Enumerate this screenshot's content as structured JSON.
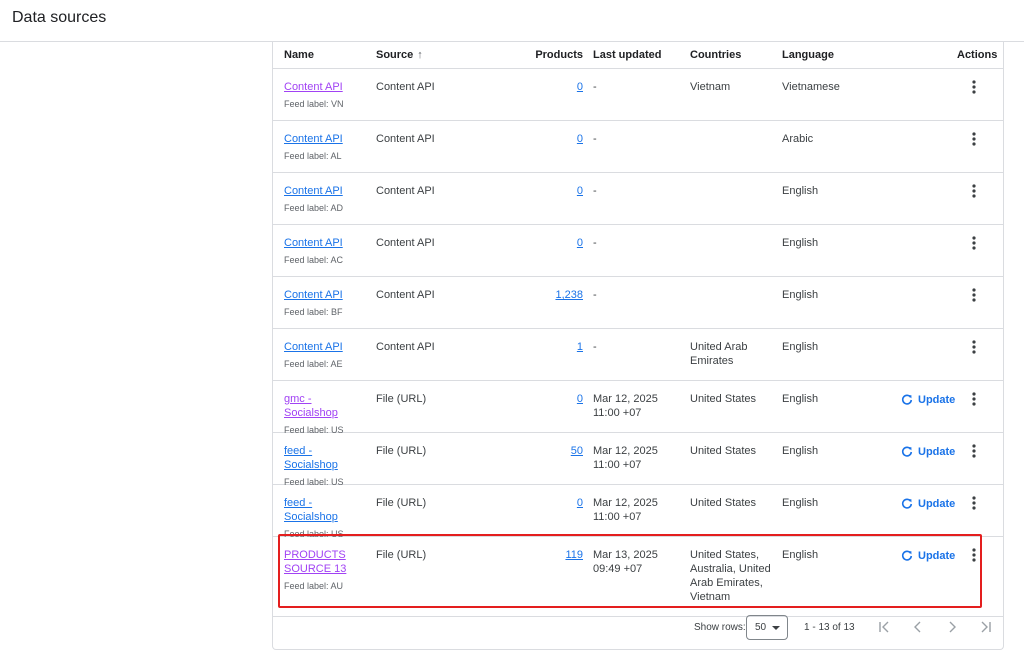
{
  "page": {
    "title": "Data sources"
  },
  "table": {
    "headers": {
      "name": "Name",
      "source": "Source",
      "products": "Products",
      "last_updated": "Last updated",
      "countries": "Countries",
      "language": "Language",
      "actions": "Actions"
    },
    "rows": [
      {
        "name": "Content API",
        "visited": true,
        "feed_label": "Feed label: VN",
        "source": "Content API",
        "products": "0",
        "last_updated": "-",
        "countries": "Vietnam",
        "language": "Vietnamese",
        "update": ""
      },
      {
        "name": "Content API",
        "visited": false,
        "feed_label": "Feed label: AL",
        "source": "Content API",
        "products": "0",
        "last_updated": "-",
        "countries": "",
        "language": "Arabic",
        "update": ""
      },
      {
        "name": "Content API",
        "visited": false,
        "feed_label": "Feed label: AD",
        "source": "Content API",
        "products": "0",
        "last_updated": "-",
        "countries": "",
        "language": "English",
        "update": ""
      },
      {
        "name": "Content API",
        "visited": false,
        "feed_label": "Feed label: AC",
        "source": "Content API",
        "products": "0",
        "last_updated": "-",
        "countries": "",
        "language": "English",
        "update": ""
      },
      {
        "name": "Content API",
        "visited": false,
        "feed_label": "Feed label: BF",
        "source": "Content API",
        "products": "1,238",
        "last_updated": "-",
        "countries": "",
        "language": "English",
        "update": ""
      },
      {
        "name": "Content API",
        "visited": false,
        "feed_label": "Feed label: AE",
        "source": "Content API",
        "products": "1",
        "last_updated": "-",
        "countries": "United Arab Emirates",
        "language": "English",
        "update": ""
      },
      {
        "name": "gmc - Socialshop",
        "visited": true,
        "feed_label": "Feed label: US",
        "source": "File (URL)",
        "products": "0",
        "last_updated": "Mar 12, 2025 11:00 +07",
        "countries": "United States",
        "language": "English",
        "update": "Update"
      },
      {
        "name": "feed - Socialshop",
        "visited": false,
        "feed_label": "Feed label: US",
        "source": "File (URL)",
        "products": "50",
        "last_updated": "Mar 12, 2025 11:00 +07",
        "countries": "United States",
        "language": "English",
        "update": "Update"
      },
      {
        "name": "feed - Socialshop",
        "visited": false,
        "feed_label": "Feed label: US",
        "source": "File (URL)",
        "products": "0",
        "last_updated": "Mar 12, 2025 11:00 +07",
        "countries": "United States",
        "language": "English",
        "update": "Update"
      },
      {
        "name": "PRODUCTS SOURCE 13",
        "visited": true,
        "feed_label": "Feed label: AU",
        "source": "File (URL)",
        "products": "119",
        "last_updated": "Mar 13, 2025 09:49 +07",
        "countries": "United States, Australia, United Arab Emirates, Vietnam",
        "language": "English",
        "update": "Update"
      }
    ]
  },
  "pagination": {
    "show_rows_label": "Show rows:",
    "rows_per_page": "50",
    "range": "1 - 13 of 13"
  },
  "colors": {
    "link": "#1a73e8",
    "visited_link": "#a142f4",
    "highlight": "#e41e1e"
  }
}
